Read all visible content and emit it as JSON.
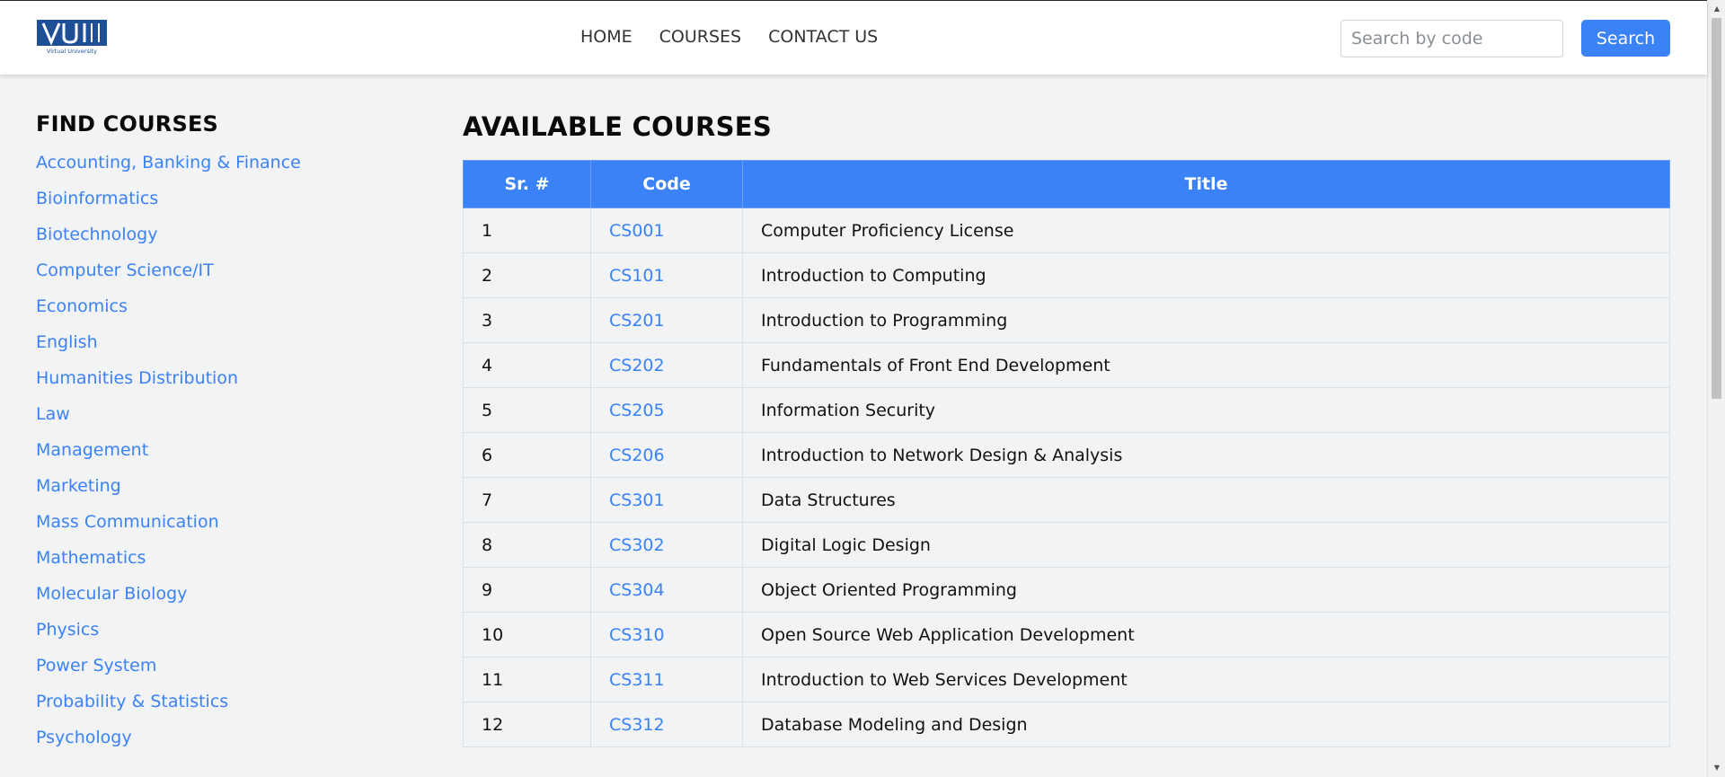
{
  "header": {
    "logo_text": "VU",
    "logo_subtitle": "Virtual University",
    "nav": [
      "HOME",
      "COURSES",
      "CONTACT US"
    ],
    "search": {
      "placeholder": "Search by code",
      "button_label": "Search"
    }
  },
  "sidebar": {
    "title": "FIND COURSES",
    "items": [
      "Accounting, Banking & Finance",
      "Bioinformatics",
      "Biotechnology",
      "Computer Science/IT",
      "Economics",
      "English",
      "Humanities Distribution",
      "Law",
      "Management",
      "Marketing",
      "Mass Communication",
      "Mathematics",
      "Molecular Biology",
      "Physics",
      "Power System",
      "Probability & Statistics",
      "Psychology"
    ]
  },
  "main": {
    "title": "AVAILABLE COURSES",
    "table": {
      "headers": [
        "Sr. #",
        "Code",
        "Title"
      ],
      "rows": [
        {
          "sr": "1",
          "code": "CS001",
          "title": "Computer Proficiency License"
        },
        {
          "sr": "2",
          "code": "CS101",
          "title": "Introduction to Computing"
        },
        {
          "sr": "3",
          "code": "CS201",
          "title": "Introduction to Programming"
        },
        {
          "sr": "4",
          "code": "CS202",
          "title": "Fundamentals of Front End Development"
        },
        {
          "sr": "5",
          "code": "CS205",
          "title": "Information Security"
        },
        {
          "sr": "6",
          "code": "CS206",
          "title": "Introduction to Network Design & Analysis"
        },
        {
          "sr": "7",
          "code": "CS301",
          "title": "Data Structures"
        },
        {
          "sr": "8",
          "code": "CS302",
          "title": "Digital Logic Design"
        },
        {
          "sr": "9",
          "code": "CS304",
          "title": "Object Oriented Programming"
        },
        {
          "sr": "10",
          "code": "CS310",
          "title": "Open Source Web Application Development"
        },
        {
          "sr": "11",
          "code": "CS311",
          "title": "Introduction to Web Services Development"
        },
        {
          "sr": "12",
          "code": "CS312",
          "title": "Database Modeling and Design"
        }
      ]
    }
  },
  "colors": {
    "accent": "#3b82f6",
    "page_background": "#f2f3f5",
    "navbar_background": "#ffffff",
    "logo_blue": "#1f4f96"
  }
}
